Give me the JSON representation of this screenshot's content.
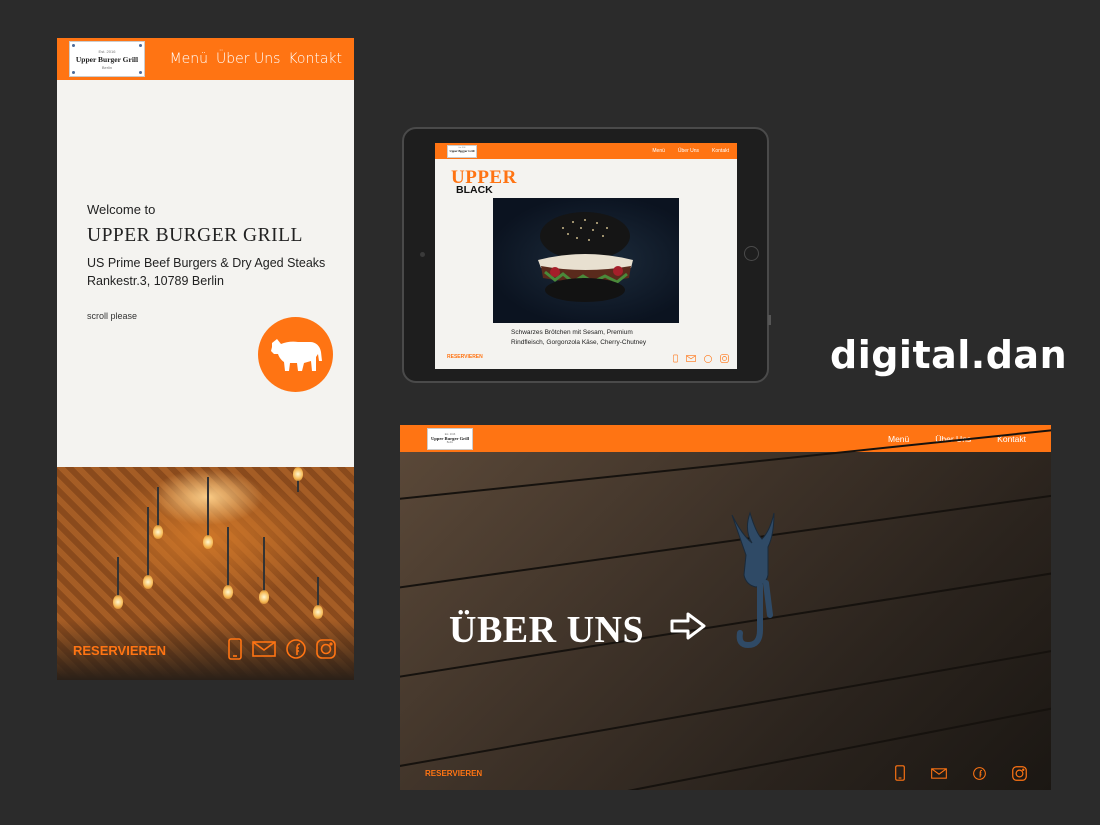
{
  "brand": "digital.dan",
  "logo": {
    "est": "Est. 2016",
    "name": "Upper Burger Grill",
    "city": "Berlin"
  },
  "nav": {
    "menu": "Menü",
    "about": "Über Uns",
    "contact": "Kontakt"
  },
  "reserve_label": "RESERVIEREN",
  "icons": [
    "phone-icon",
    "mail-icon",
    "facebook-icon",
    "instagram-icon"
  ],
  "colors": {
    "accent": "#ff7413",
    "background": "#2b2b2b",
    "page": "#f4f3f0"
  },
  "phone": {
    "welcome": "Welcome to",
    "title": "UPPER BURGER GRILL",
    "subtitle": "US Prime Beef Burgers & Dry Aged Steaks",
    "address": "Rankestr.3, 10789 Berlin",
    "scroll_hint": "scroll please"
  },
  "tablet": {
    "title_line1": "UPPER",
    "title_line2": "BLACK",
    "description_line1": "Schwarzes Brötchen mit Sesam, Premium",
    "description_line2": "Rindfleisch, Gorgonzola Käse, Cherry-Chutney"
  },
  "desktop": {
    "heading": "ÜBER UNS"
  }
}
